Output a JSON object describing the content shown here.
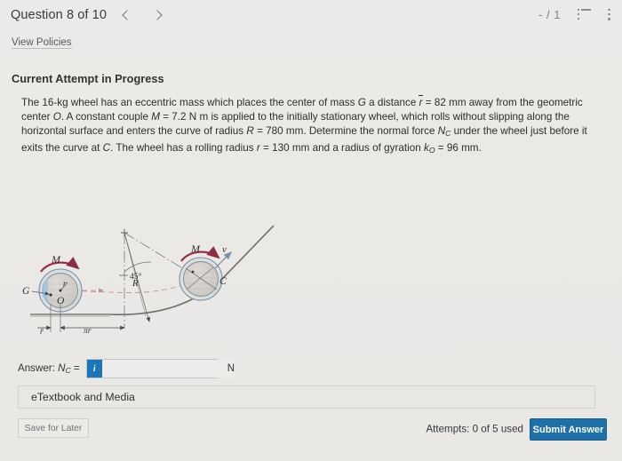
{
  "header": {
    "question_title": "Question 8 of 10",
    "prev_icon": "chevron-left-icon",
    "next_icon": "chevron-right-icon",
    "score": "- / 1",
    "list_icon": "list-icon",
    "menu_icon": "kebab-menu-icon"
  },
  "policies": {
    "link_label": "View Policies"
  },
  "attempt": {
    "heading": "Current Attempt in Progress"
  },
  "question": {
    "line1_a": "The 16-kg wheel has an eccentric mass which places the center of mass ",
    "G": "G",
    "line1_b": " a distance ",
    "rbar": "r",
    "line1_c": " = 82 mm away from the geometric center ",
    "O": "O",
    "line1_d": ". A constant couple ",
    "M": "M",
    "line2_a": " = 7.2 N",
    "line2_b": " m is applied to the initially stationary wheel, which rolls without slipping along the horizontal surface and enters the curve of radius ",
    "R": "R",
    "line3_a": " = 780 mm. Determine the normal force ",
    "N": "N",
    "N_sub": "C",
    "line3_b": " under the wheel just before it exits the curve at ",
    "C": "C",
    "line3_c": ". The wheel has a rolling radius ",
    "r": "r",
    "line4_a": " = 130 mm and a radius of gyration ",
    "k": "k",
    "k_sub": "O",
    "line4_b": " = 96 mm."
  },
  "figure": {
    "label_G": "G",
    "label_O": "O",
    "label_C": "C",
    "label_M_left": "M",
    "label_M_right": "M",
    "label_v": "v",
    "label_R": "R",
    "label_r_inner": "r",
    "label_rbar": "r",
    "label_pir": "πr",
    "label_angle": "45°"
  },
  "answer": {
    "label_prefix": "Answer: ",
    "label_symbol": "N",
    "label_subscript": "C",
    "label_equals": " =",
    "info_icon": "info-icon",
    "info_glyph": "i",
    "value": "",
    "placeholder": "",
    "unit": "N"
  },
  "etextbook": {
    "label": "eTextbook and Media"
  },
  "footer": {
    "save_label": "Save for Later",
    "attempts": "Attempts: 0 of 5 used",
    "submit_label": "Submit Answer"
  },
  "colors": {
    "accent_blue": "#1f6fa8",
    "info_blue": "#1976bd",
    "page_bg": "#ebeae8",
    "arrow_red": "#9e2740"
  }
}
